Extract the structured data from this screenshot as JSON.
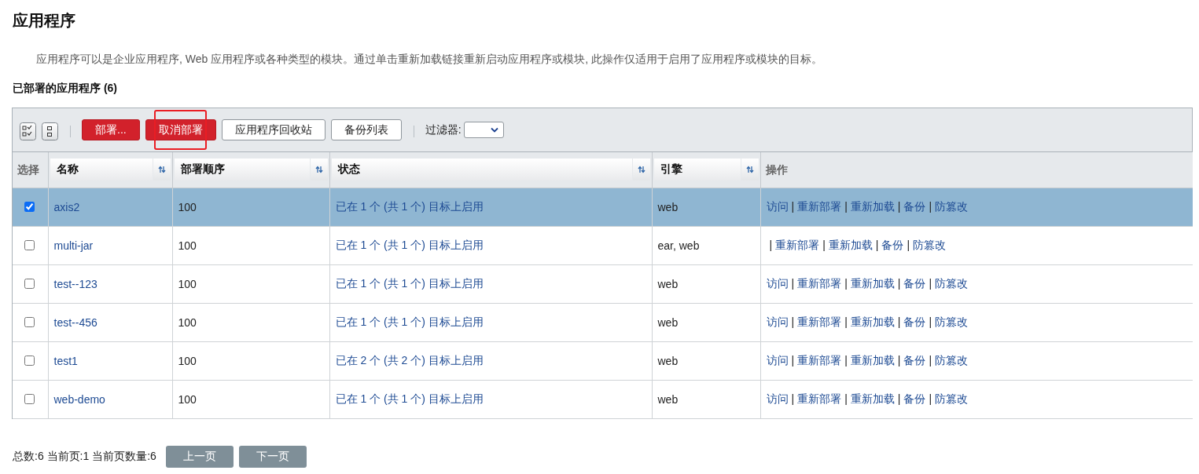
{
  "page": {
    "title": "应用程序",
    "description": "应用程序可以是企业应用程序, Web 应用程序或各种类型的模块。通过单击重新加载链接重新启动应用程序或模块, 此操作仅适用于启用了应用程序或模块的目标。"
  },
  "table": {
    "title": "已部署的应用程序 (6)",
    "toolbar": {
      "buttons": [
        {
          "label": "部署...",
          "kind": "primary",
          "highlighted": false
        },
        {
          "label": "取消部署",
          "kind": "primary",
          "highlighted": true
        },
        {
          "label": "应用程序回收站",
          "kind": "default",
          "highlighted": false
        },
        {
          "label": "备份列表",
          "kind": "default",
          "highlighted": false
        }
      ],
      "filter": {
        "label": "过滤器:"
      }
    },
    "columns": [
      {
        "label": "选择",
        "sortable": false
      },
      {
        "label": "名称",
        "sortable": true
      },
      {
        "label": "部署顺序",
        "sortable": true
      },
      {
        "label": "状态",
        "sortable": true
      },
      {
        "label": "引擎",
        "sortable": true
      },
      {
        "label": "操作",
        "sortable": false
      }
    ],
    "rows": [
      {
        "selected": true,
        "checked": true,
        "name": "axis2",
        "order": "100",
        "status": "已在 1 个 (共 1 个) 目标上启用",
        "engine": "web",
        "actions": [
          {
            "kind": "link",
            "text": "访问"
          },
          {
            "kind": "sep",
            "text": "|"
          },
          {
            "kind": "link",
            "text": "重新部署"
          },
          {
            "kind": "sep",
            "text": "|"
          },
          {
            "kind": "link",
            "text": "重新加载"
          },
          {
            "kind": "sep",
            "text": "|"
          },
          {
            "kind": "link",
            "text": "备份"
          },
          {
            "kind": "sep",
            "text": "|"
          },
          {
            "kind": "link",
            "text": "防篡改"
          }
        ]
      },
      {
        "selected": false,
        "checked": false,
        "name": "multi-jar",
        "order": "100",
        "status": "已在 1 个 (共 1 个) 目标上启用",
        "engine": "ear, web",
        "actions": [
          {
            "kind": "sep",
            "text": "|"
          },
          {
            "kind": "link",
            "text": "重新部署"
          },
          {
            "kind": "sep",
            "text": "|"
          },
          {
            "kind": "link",
            "text": "重新加载"
          },
          {
            "kind": "sep",
            "text": "|"
          },
          {
            "kind": "link",
            "text": "备份"
          },
          {
            "kind": "sep",
            "text": "|"
          },
          {
            "kind": "link",
            "text": "防篡改"
          }
        ]
      },
      {
        "selected": false,
        "checked": false,
        "name": "test--123",
        "order": "100",
        "status": "已在 1 个 (共 1 个) 目标上启用",
        "engine": "web",
        "actions": [
          {
            "kind": "link",
            "text": "访问"
          },
          {
            "kind": "sep",
            "text": "|"
          },
          {
            "kind": "link",
            "text": "重新部署"
          },
          {
            "kind": "sep",
            "text": "|"
          },
          {
            "kind": "link",
            "text": "重新加载"
          },
          {
            "kind": "sep",
            "text": "|"
          },
          {
            "kind": "link",
            "text": "备份"
          },
          {
            "kind": "sep",
            "text": "|"
          },
          {
            "kind": "link",
            "text": "防篡改"
          }
        ]
      },
      {
        "selected": false,
        "checked": false,
        "name": "test--456",
        "order": "100",
        "status": "已在 1 个 (共 1 个) 目标上启用",
        "engine": "web",
        "actions": [
          {
            "kind": "link",
            "text": "访问"
          },
          {
            "kind": "sep",
            "text": "|"
          },
          {
            "kind": "link",
            "text": "重新部署"
          },
          {
            "kind": "sep",
            "text": "|"
          },
          {
            "kind": "link",
            "text": "重新加载"
          },
          {
            "kind": "sep",
            "text": "|"
          },
          {
            "kind": "link",
            "text": "备份"
          },
          {
            "kind": "sep",
            "text": "|"
          },
          {
            "kind": "link",
            "text": "防篡改"
          }
        ]
      },
      {
        "selected": false,
        "checked": false,
        "name": "test1",
        "order": "100",
        "status": "已在 2 个 (共 2 个) 目标上启用",
        "engine": "web",
        "actions": [
          {
            "kind": "link",
            "text": "访问"
          },
          {
            "kind": "sep",
            "text": "|"
          },
          {
            "kind": "link",
            "text": "重新部署"
          },
          {
            "kind": "sep",
            "text": "|"
          },
          {
            "kind": "link",
            "text": "重新加载"
          },
          {
            "kind": "sep",
            "text": "|"
          },
          {
            "kind": "link",
            "text": "备份"
          },
          {
            "kind": "sep",
            "text": "|"
          },
          {
            "kind": "link",
            "text": "防篡改"
          }
        ]
      },
      {
        "selected": false,
        "checked": false,
        "name": "web-demo",
        "order": "100",
        "status": "已在 1 个 (共 1 个) 目标上启用",
        "engine": "web",
        "actions": [
          {
            "kind": "link",
            "text": "访问"
          },
          {
            "kind": "sep",
            "text": "|"
          },
          {
            "kind": "link",
            "text": "重新部署"
          },
          {
            "kind": "sep",
            "text": "|"
          },
          {
            "kind": "link",
            "text": "重新加载"
          },
          {
            "kind": "sep",
            "text": "|"
          },
          {
            "kind": "link",
            "text": "备份"
          },
          {
            "kind": "sep",
            "text": "|"
          },
          {
            "kind": "link",
            "text": "防篡改"
          }
        ]
      }
    ]
  },
  "pagination": {
    "summary": "总数:6 当前页:1 当前页数量:6",
    "buttons": [
      "上一页",
      "下一页"
    ]
  }
}
